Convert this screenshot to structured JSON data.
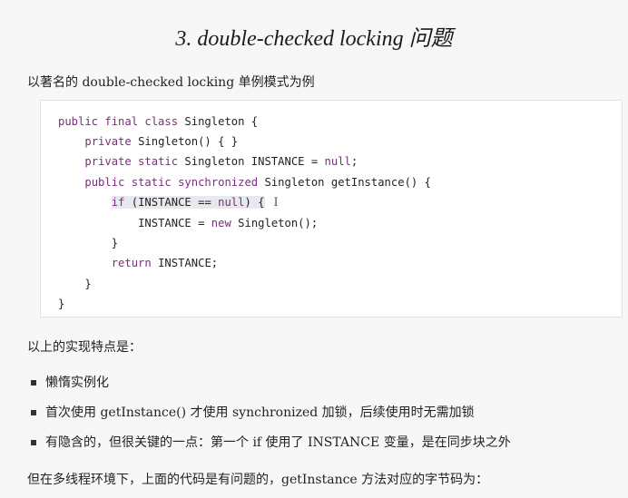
{
  "title": "3. double-checked locking 问题",
  "intro": "以著名的 double-checked locking 单例模式为例",
  "code": {
    "lines": [
      {
        "indent": 0,
        "tokens": [
          {
            "t": "public final class ",
            "kw": true
          },
          {
            "t": "Singleton {"
          }
        ]
      },
      {
        "indent": 1,
        "tokens": [
          {
            "t": "private ",
            "kw": true
          },
          {
            "t": "Singleton() { }"
          }
        ]
      },
      {
        "indent": 1,
        "tokens": [
          {
            "t": "private static ",
            "kw": true
          },
          {
            "t": "Singleton INSTANCE = "
          },
          {
            "t": "null",
            "kw": true
          },
          {
            "t": ";"
          }
        ]
      },
      {
        "indent": 1,
        "tokens": [
          {
            "t": "public static synchronized ",
            "kw": true
          },
          {
            "t": "Singleton getInstance() {"
          }
        ]
      },
      {
        "indent": 2,
        "highlight": true,
        "tokens": [
          {
            "t": "if",
            "kw": true
          },
          {
            "t": " (INSTANCE == "
          },
          {
            "t": "null",
            "kw": true
          },
          {
            "t": ") {"
          }
        ]
      },
      {
        "indent": 3,
        "tokens": [
          {
            "t": "INSTANCE = "
          },
          {
            "t": "new ",
            "kw": true
          },
          {
            "t": "Singleton();"
          }
        ]
      },
      {
        "indent": 2,
        "tokens": [
          {
            "t": "}"
          }
        ]
      },
      {
        "indent": 2,
        "tokens": [
          {
            "t": "return ",
            "kw": true
          },
          {
            "t": "INSTANCE;"
          }
        ]
      },
      {
        "indent": 1,
        "tokens": [
          {
            "t": "}"
          }
        ]
      },
      {
        "indent": 0,
        "tokens": [
          {
            "t": "}"
          }
        ]
      }
    ]
  },
  "summary": "以上的实现特点是：",
  "bullets": [
    "懒惰实例化",
    "首次使用 getInstance() 才使用 synchronized 加锁，后续使用时无需加锁",
    "有隐含的，但很关键的一点：第一个 if 使用了 INSTANCE 变量，是在同步块之外"
  ],
  "footer": "但在多线程环境下，上面的代码是有问题的，getInstance 方法对应的字节码为：",
  "cursor_glyph": "I"
}
